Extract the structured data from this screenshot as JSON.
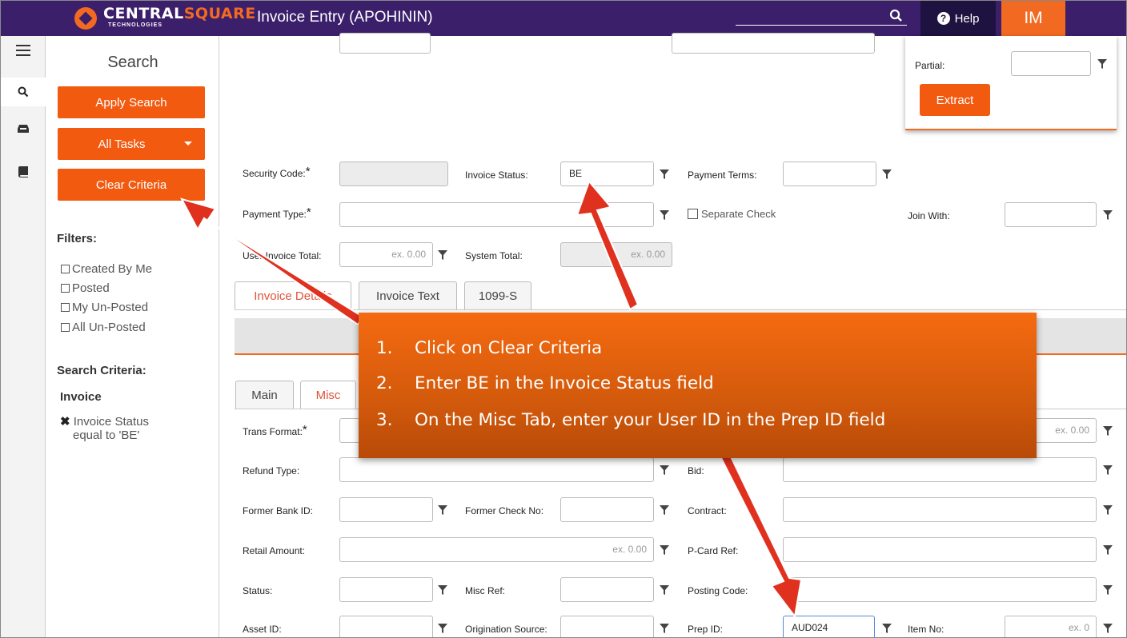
{
  "header": {
    "brand_text_a": "CENTRAL",
    "brand_text_b": "SQUARE",
    "brand_sub": "TECHNOLOGIES",
    "title": "Invoice Entry (APOHININ)",
    "help_label": "Help",
    "user_initials": "IM",
    "colors": {
      "bar": "#3b1f6b",
      "accent": "#f26a21",
      "help_bg": "#1e1240"
    }
  },
  "rail": {
    "icons": [
      "menu-icon",
      "search-icon",
      "inbox-icon",
      "book-icon"
    ]
  },
  "search_panel": {
    "title": "Search",
    "apply_label": "Apply Search",
    "tasks_label": "All Tasks",
    "clear_label": "Clear Criteria",
    "filters_heading": "Filters:",
    "filters": [
      "Created By Me",
      "Posted",
      "My Un-Posted",
      "All Un-Posted"
    ],
    "criteria_heading": "Search Criteria:",
    "criteria_group": "Invoice",
    "criteria_item_line1": "Invoice Status",
    "criteria_item_line2": "equal to 'BE'"
  },
  "popup": {
    "partial_label": "Partial:",
    "extract_label": "Extract"
  },
  "form": {
    "security_code_label": "Security Code:",
    "invoice_status_label": "Invoice Status:",
    "invoice_status_value": "BE",
    "payment_terms_label": "Payment Terms:",
    "payment_type_label": "Payment Type:",
    "separate_check_label": "Separate Check",
    "join_with_label": "Join With:",
    "user_invoice_total_label": "User Invoice Total:",
    "user_invoice_total_placeholder": "ex. 0.00",
    "system_total_label": "System Total:",
    "system_total_placeholder": "ex. 0.00"
  },
  "tabs_top": [
    "Invoice Details",
    "Invoice Text",
    "1099-S"
  ],
  "tabs_sub": [
    "Main",
    "Misc"
  ],
  "misc": {
    "trans_format_label": "Trans Format:",
    "right_amount_placeholder": "ex. 0.00",
    "refund_type_label": "Refund Type:",
    "bid_label": "Bid:",
    "former_bank_label": "Former Bank ID:",
    "former_check_label": "Former Check No:",
    "contract_label": "Contract:",
    "retail_amount_label": "Retail Amount:",
    "retail_amount_placeholder": "ex. 0.00",
    "pcard_label": "P-Card Ref:",
    "status_label": "Status:",
    "misc_ref_label": "Misc Ref:",
    "posting_code_label": "Posting Code:",
    "asset_id_label": "Asset ID:",
    "origination_label": "Origination Source:",
    "prep_id_label": "Prep ID:",
    "prep_id_value": "AUD024",
    "item_no_label": "Item No:",
    "item_no_placeholder": "ex. 0"
  },
  "callout": {
    "steps": [
      {
        "num": "1.",
        "text": "Click on Clear Criteria"
      },
      {
        "num": "2.",
        "text": "Enter BE in the Invoice Status field"
      },
      {
        "num": "3.",
        "text": "On the Misc Tab, enter your User ID in the Prep ID field"
      }
    ],
    "arrow_color": "#e0301e"
  }
}
